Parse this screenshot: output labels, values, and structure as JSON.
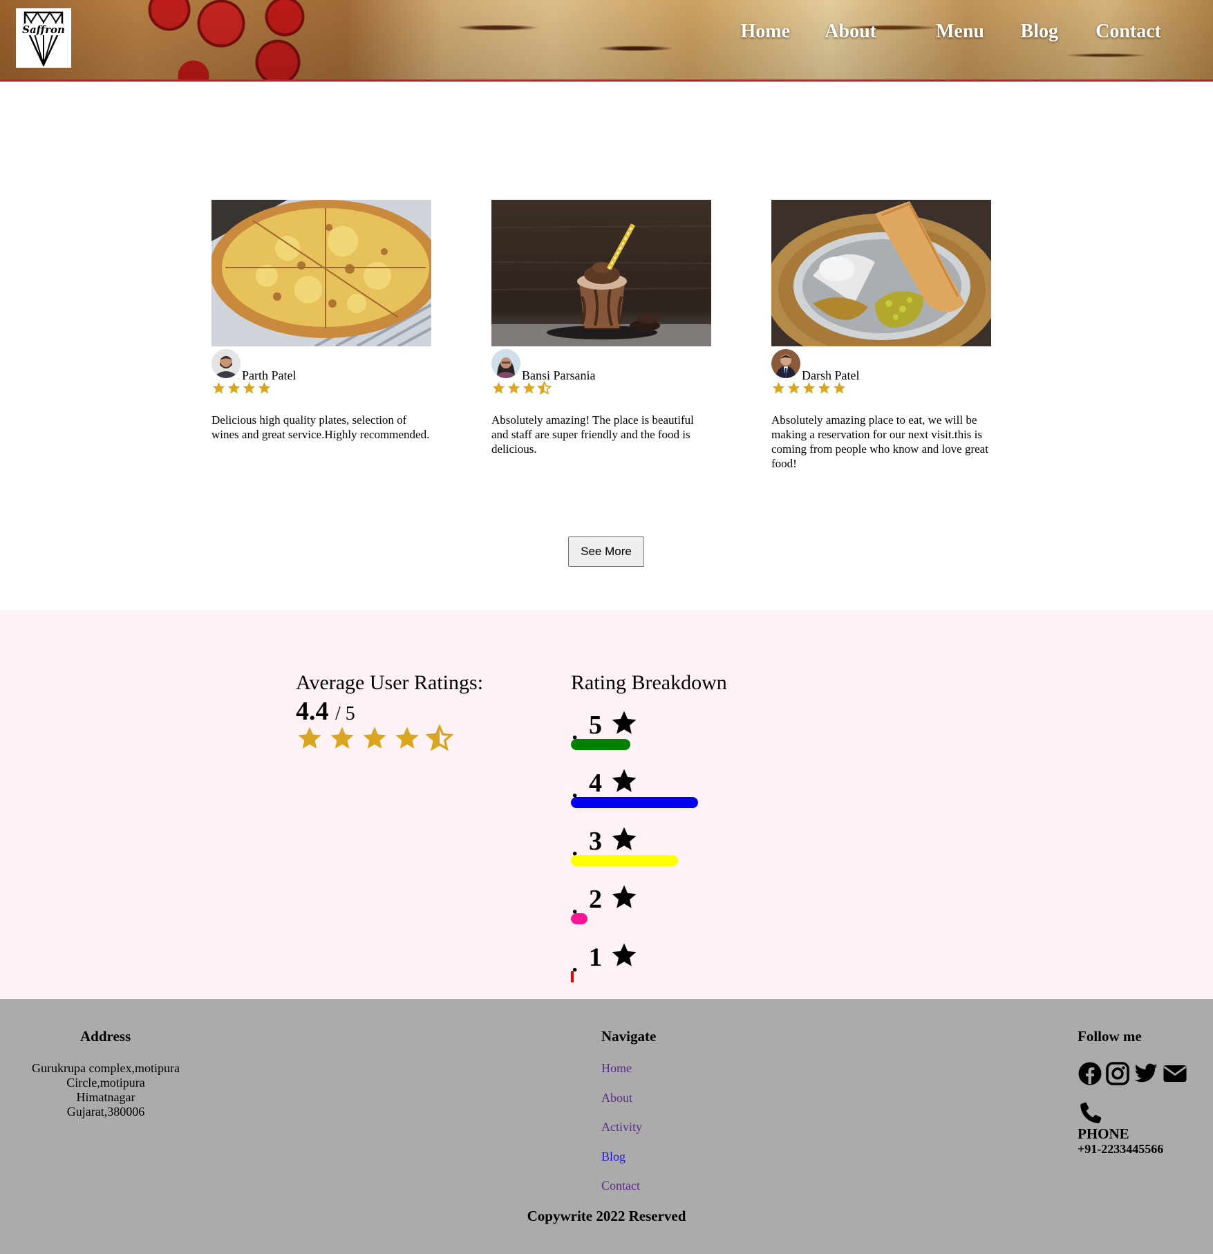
{
  "header": {
    "logo_text": "Saffron",
    "nav": [
      {
        "label": "Home"
      },
      {
        "label": "About"
      },
      {
        "label": "Menu"
      },
      {
        "label": "Blog"
      },
      {
        "label": "Contact"
      }
    ]
  },
  "reviews": [
    {
      "image_icon": "pizza-photo",
      "name": "Parth Patel",
      "rating": 4,
      "text": "Delicious high quality plates, selection of wines and great service.Highly recommended."
    },
    {
      "image_icon": "milkshake-photo",
      "name": "Bansi Parsania",
      "rating": 3.5,
      "text": "Absolutely amazing! The place is beautiful and staff are super friendly and the food is delicious."
    },
    {
      "image_icon": "dosa-thali-photo",
      "name": "Darsh Patel",
      "rating": 5,
      "text": "Absolutely amazing place to eat, we will be making a reservation for our next visit.this is coming from people who know and love great food!"
    }
  ],
  "see_more_label": "See More",
  "ratings": {
    "average_title": "Average User Ratings:",
    "average_value": "4.4",
    "average_out_of": "/ 5",
    "average_stars": 4.5,
    "breakdown_title": "Rating Breakdown",
    "breakdown": [
      {
        "stars": "5",
        "fraction": 0.47,
        "color": "#008000"
      },
      {
        "stars": "4",
        "fraction": 1.0,
        "color": "#0000ee"
      },
      {
        "stars": "3",
        "fraction": 0.84,
        "color": "#ffff00"
      },
      {
        "stars": "2",
        "fraction": 0.13,
        "color": "#ff1493"
      },
      {
        "stars": "1",
        "fraction": 0.02,
        "color": "#e00000"
      }
    ],
    "star_color": "#daa520"
  },
  "footer": {
    "address_heading": "Address",
    "address_lines": [
      "Gurukrupa complex,motipura",
      "Circle,motipura",
      "Himatnagar",
      "Gujarat,380006"
    ],
    "navigate_heading": "Navigate",
    "nav_links": [
      {
        "label": "Home"
      },
      {
        "label": "About"
      },
      {
        "label": "Activity"
      },
      {
        "label": "Blog"
      },
      {
        "label": "Contact"
      }
    ],
    "follow_heading": "Follow me",
    "social_icons": [
      "facebook-icon",
      "instagram-icon",
      "twitter-icon",
      "email-icon"
    ],
    "phone_label": "PHONE",
    "phone_number": "+91-2233445566",
    "copyright": "Copywrite 2022 Reserved"
  }
}
